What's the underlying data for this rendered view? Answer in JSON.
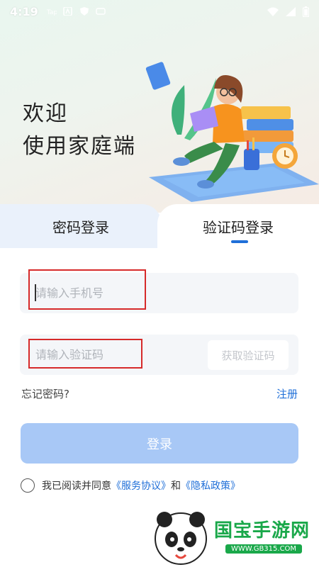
{
  "status_bar": {
    "time": "4:19",
    "left_icons": [
      "tap-icon",
      "a-icon",
      "shield-icon",
      "notification-icon"
    ],
    "right_icons": [
      "wifi-icon",
      "signal-icon",
      "battery-icon"
    ]
  },
  "hero": {
    "greeting_line1": "欢迎",
    "greeting_line2": "使用家庭端"
  },
  "tabs": {
    "password_login": "密码登录",
    "code_login": "验证码登录",
    "active": "code_login"
  },
  "form": {
    "phone_placeholder": "请输入手机号",
    "code_placeholder": "请输入验证码",
    "get_code_label": "获取验证码",
    "forgot_label": "忘记密码?",
    "register_label": "注册",
    "login_label": "登录"
  },
  "agreement": {
    "prefix": "我已阅读并同意",
    "service_link": "《服务协议》",
    "and": "和",
    "privacy_link": "《隐私政策》"
  },
  "watermark": {
    "brand": "国宝手游网",
    "url": "WWW.GB315.COM"
  },
  "colors": {
    "accent": "#1f6fd8",
    "login_button": "#a8c8f6",
    "tab_inactive_bg": "#eaf1fb",
    "field_bg": "#f4f6f9"
  }
}
